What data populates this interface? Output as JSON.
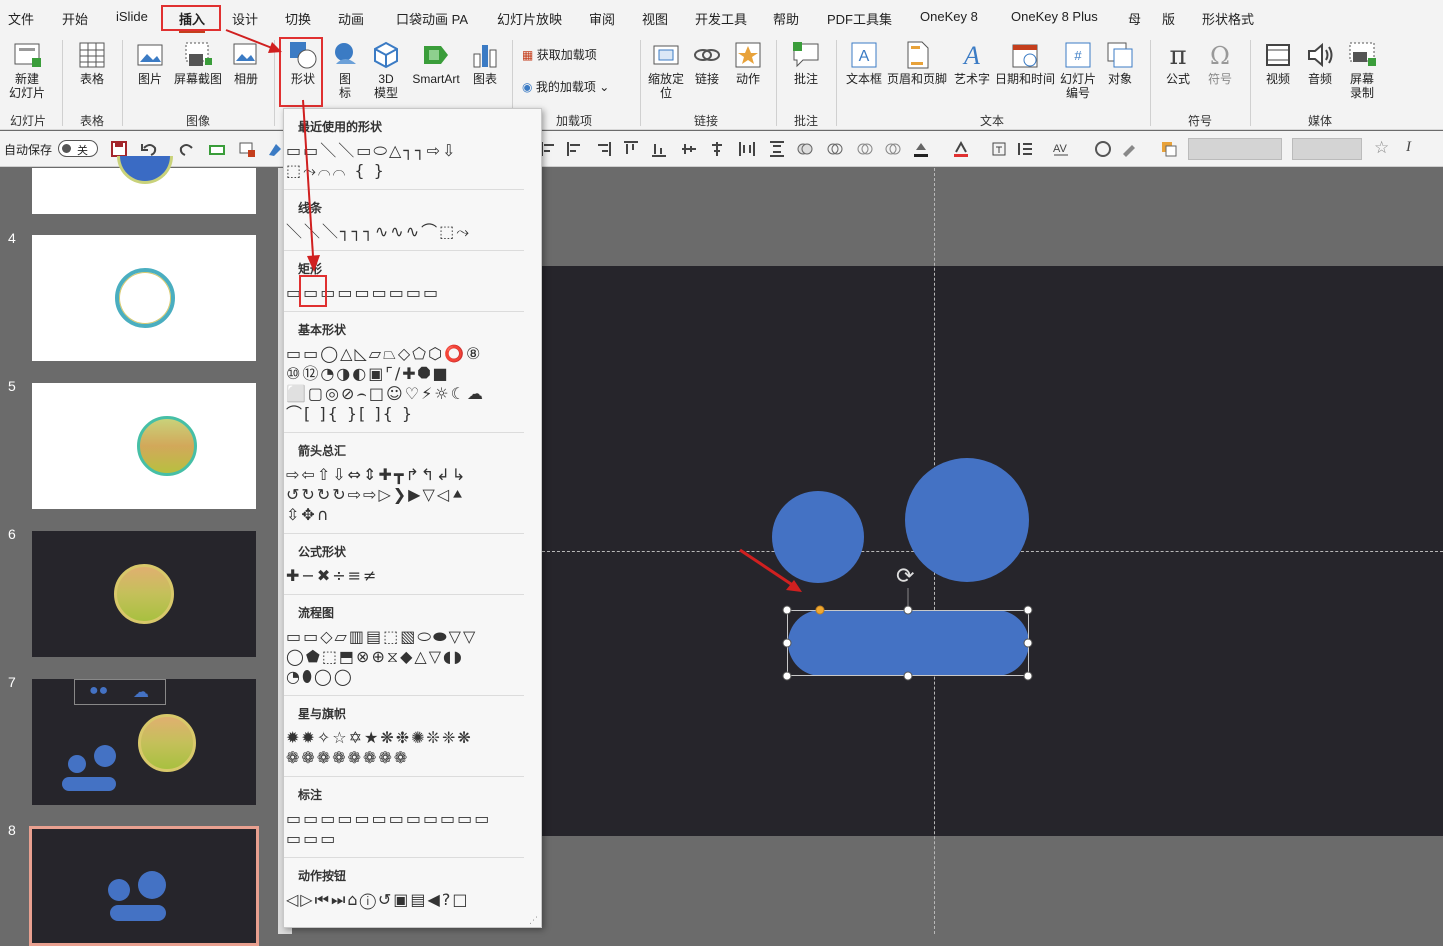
{
  "menu": {
    "tabs": [
      "文件",
      "开始",
      "iSlide",
      "插入",
      "设计",
      "切换",
      "动画",
      "口袋动画 PA",
      "幻灯片放映",
      "审阅",
      "视图",
      "开发工具",
      "帮助",
      "PDF工具集",
      "OneKey 8",
      "OneKey 8 Plus",
      "母",
      "版",
      "形状格式"
    ],
    "active_tab": "插入"
  },
  "ribbon": {
    "new_slide": "新建\n幻灯片",
    "table": "表格",
    "picture": "图片",
    "screenshot": "屏幕截图",
    "album": "相册",
    "shapes": "形状",
    "icons": "图\n标",
    "model3d": "3D\n模型",
    "smartart": "SmartArt",
    "chart": "图表",
    "get_addins": "获取加载项",
    "my_addins": "我的加载项",
    "zoom": "缩放定\n位",
    "link": "链接",
    "action": "动作",
    "comment": "批注",
    "textbox": "文本框",
    "header_footer": "页眉和页脚",
    "wordart": "艺术字",
    "datetime": "日期和时间",
    "slide_number": "幻灯片\n编号",
    "object": "对象",
    "equation": "公式",
    "symbol": "符号",
    "video": "视频",
    "audio": "音频",
    "screen_record": "屏幕\n录制",
    "groups": {
      "slides": "幻灯片",
      "tables": "表格",
      "images": "图像",
      "addins": "加载项",
      "links": "链接",
      "comments": "批注",
      "text": "文本",
      "symbols": "符号",
      "media": "媒体"
    }
  },
  "qat": {
    "autosave_label": "自动保存",
    "autosave_state": "关"
  },
  "thumbnails": [
    "4",
    "5",
    "6",
    "7",
    "8"
  ],
  "shapes_dropdown": {
    "sections": [
      "最近使用的形状",
      "线条",
      "矩形",
      "基本形状",
      "箭头总汇",
      "公式形状",
      "流程图",
      "星与旗帜",
      "标注",
      "动作按钮"
    ],
    "rows": {
      "recent": [
        "▭▭＼＼▭⬭△┐┐⇨⇩",
        "⬚⤳⌒⌒ { }"
      ],
      "lines": [
        "＼＼＼┐┐┐∿∿∿⌒⬚⤳"
      ],
      "rect": [
        "▭▭▭▭▭▭▭▭▭"
      ],
      "basic": [
        "▭▭◯△◺▱⏢◇⬠⬡⭕⑧",
        "⑩⑫◔◑◐▣⌜∕✚⯃■",
        "⬜▢◎⊘⌢□☺♡⚡☼☾☁",
        "⌒[ ]{ }[ ]{ }"
      ],
      "arrows": [
        "⇨⇦⇧⇩⇔⇕✚┳↱↰↲↳",
        "↺↻↻↻⇨⇨▷❯▶▽◁⯅",
        "⇳✥∩"
      ],
      "equation": [
        "✚−✖÷≡≠"
      ],
      "flowchart": [
        "▭▭◇▱▥▤⬚▧⬭⬬▽▽",
        "◯⬟⬚⬒⊗⊕⧖◆△▽◖◗",
        "◔⬮◯◯"
      ],
      "stars": [
        "✹✹✧☆✡★❋❉✺❊❈❋",
        "❁❁❁❁❁❁❁❁"
      ],
      "callouts": [
        "▭▭▭▭▭▭▭▭▭▭▭▭",
        "▭▭▭"
      ],
      "action_buttons": [
        "◁▷⏮⏭⌂ⓘ↺▣▤◀?□"
      ]
    }
  },
  "colors": {
    "shape_blue": "#4472c4",
    "slide_bg": "#26252b",
    "highlight_red": "#e03030"
  }
}
